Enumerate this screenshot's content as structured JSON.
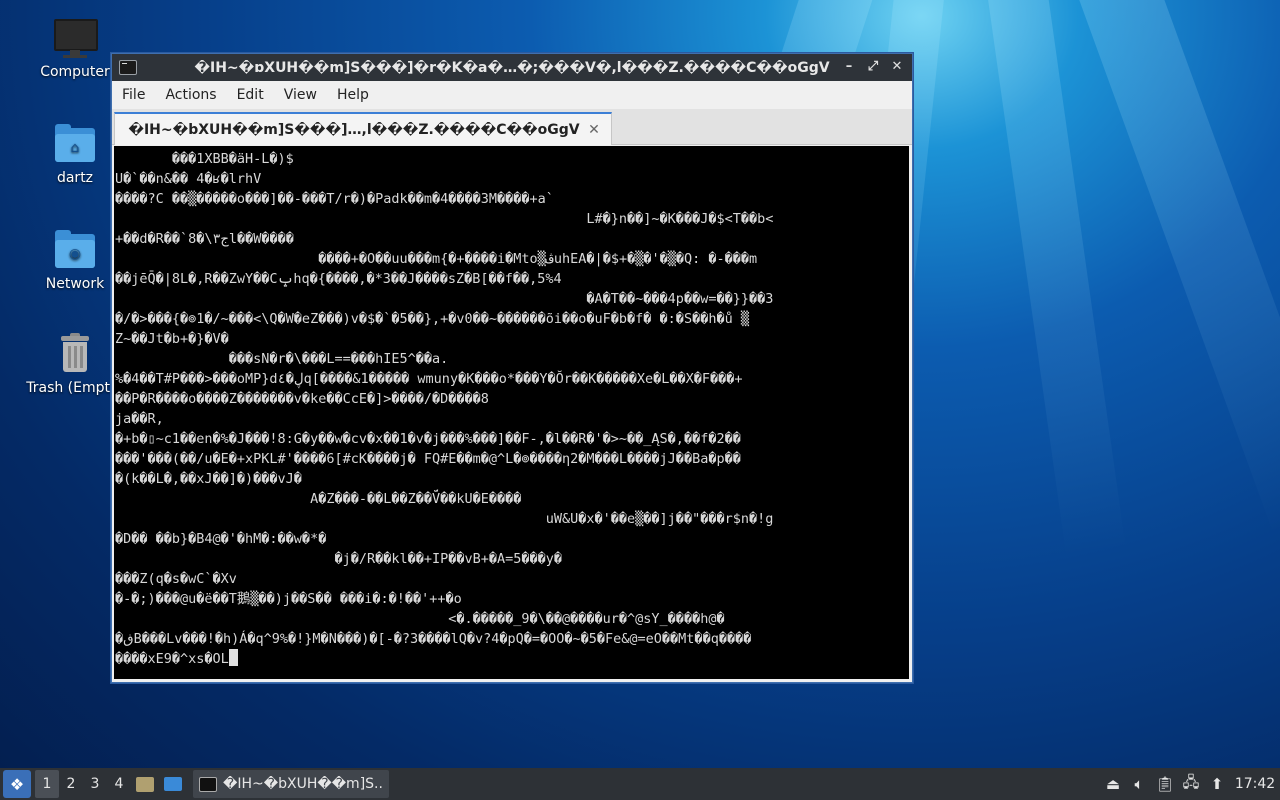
{
  "desktop": {
    "icons": [
      {
        "label": "Computer",
        "icon": "computer-icon"
      },
      {
        "label": "dartz",
        "icon": "home-folder-icon"
      },
      {
        "label": "Network",
        "icon": "network-folder-icon"
      },
      {
        "label": "Trash (Empty)",
        "icon": "trash-icon"
      }
    ]
  },
  "window": {
    "title": "�IH~�ɒXUH��m]S���]�r�K�a�…�;���V�,l���Z.����C��oGgV",
    "menu": [
      "File",
      "Actions",
      "Edit",
      "View",
      "Help"
    ],
    "tab_label": "�IH~�bXUH��m]S���]…,l���Z.����C��oGgV",
    "terminal_lines": [
      "       ���1XBB�äH-L�)$",
      "U�`��n&�� 4�ʁ�lrhV",
      "����?C ��▒�����o���]��-���T/r�)�Padk��m�4����3M����+a`",
      "                                                          L#�}n��]~�K���J�$<T��b<",
      "+��d�R��`ج٣\\�8l��W����",
      "                         ����+�O��uu���m{�+����i�Mto▒ڤuhEA�|�$+�▒�'�▒�Q: �-���m",
      "��jēQ̄�|8L�,R��ZwY��Cݒhq�{����,�*3��J����sZ�B[��f��,5%4",
      "                                                          �A�T��~���4p��w=��}}��3",
      "�/�>���{�⊚1�/~���<\\Q�W�eZ���)v�$�`�5��},+�v0��~������õi��o�uF�b�f� �:�S��h�ů ▒",
      "Z~��Jt�b+�}�V�",
      "              ���sN�r�\\���L==���hIE5^��a.",
      "%�4��T#P���>���oMP}dڸ�٤q[����&1����� wmuny�K���o*���Y�Ŏr��K�����Xe�L��X�F���+",
      "��P�R����o����Z�������v�ke��CcE�]>����/�D����8",
      "ja��R,",
      "�+b�▯~c1��en�%�J���!8:G�y��w�cv�x��1�v�j���%���]��F-,�l��R�'�>~��_ĄS�,��f�2��",
      "���'���(��/u�E�+xPKL#'����6[#cK����j� FQ#E��m�@^L�⊚����η2�M���L����jJ��Ba�p��",
      "�(k��L�,��xJ��]�)���vJ�",
      "                        A�Z���-��L��Z��V̈́��kU�E����",
      "                                                     uW&U�x�'��e▒��]j��\"���r$n�!g",
      "�D�� ��b}�B4@�'�hM�:��w�*�",
      "                           �j�/R��kl��+IP��vB+�A=5���y�",
      "���Z(q�s�wC`�Xv",
      "�-�;)���@u�ë��T鵝▒��)j��S�� ���i�:�!��'++�o",
      "                                         <�.�����_9�\\��@����ur�^@sY_����h@�",
      "�ڧB���Lv���!�h)Á�q^9%�!}M�N���)�[-�?3����lQ�v?4�pQ�=�OO�~�5�Fe&@=eO��Mt��q����",
      "����xE9�^xs�OL"
    ]
  },
  "taskbar": {
    "workspaces": [
      "1",
      "2",
      "3",
      "4"
    ],
    "active_workspace": "1",
    "task_label": "�IH~�bXUH��m]S...",
    "clock": "17:42",
    "tray_icons": [
      "eject-icon",
      "volume-icon",
      "clipboard-icon",
      "network-icon",
      "update-icon"
    ]
  }
}
